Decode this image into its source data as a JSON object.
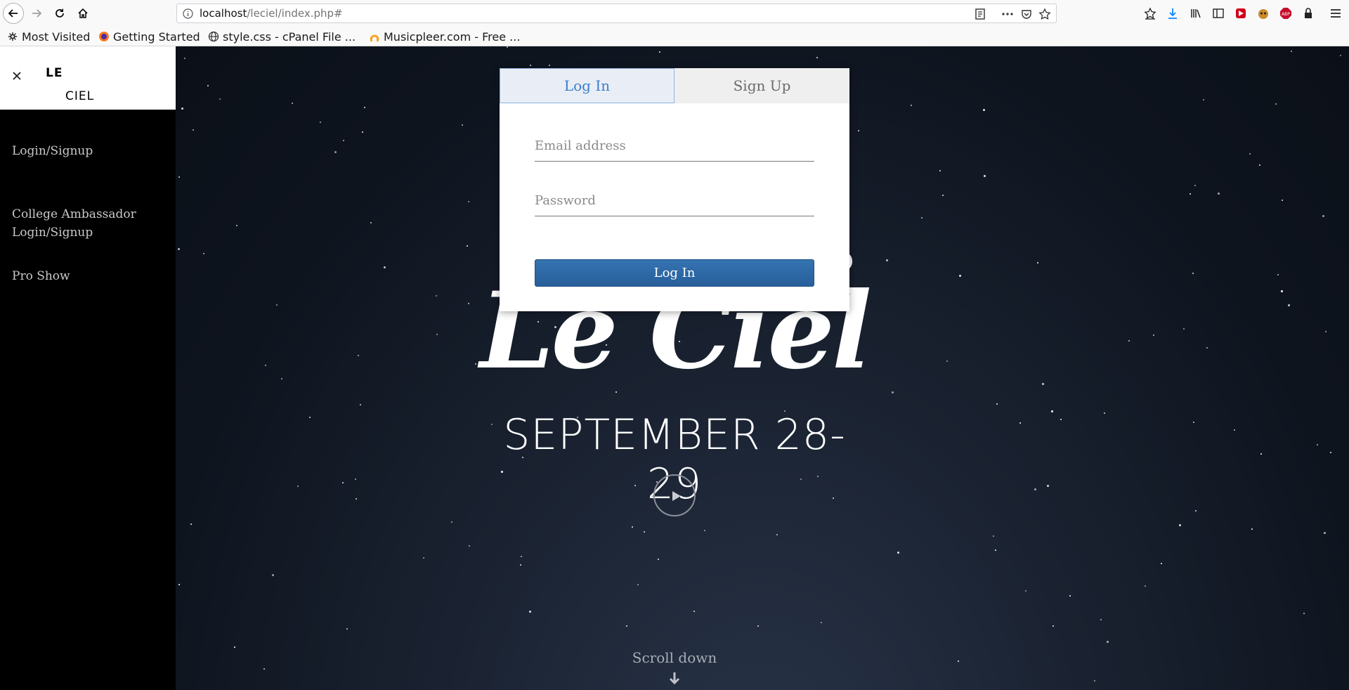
{
  "browser": {
    "url_host": "localhost",
    "url_path": "/leciel/index.php#",
    "bookmarks": [
      {
        "label": "Most Visited",
        "icon": "gear-icon"
      },
      {
        "label": "Getting Started",
        "icon": "firefox-icon"
      },
      {
        "label": "style.css - cPanel File ...",
        "icon": "globe-icon"
      },
      {
        "label": "Musicpleer.com - Free ...",
        "icon": "musicpleer-icon"
      }
    ]
  },
  "sidebar": {
    "brand_line1": "LE",
    "brand_line2": "CIEL",
    "links": [
      {
        "label": "Login/Signup"
      },
      {
        "label": "College Ambassador Login/Signup"
      },
      {
        "label": "Pro Show"
      }
    ]
  },
  "hero": {
    "logo_text": "Le Ciel",
    "date": "SEPTEMBER 28-29",
    "scroll_label": "Scroll down"
  },
  "modal": {
    "tabs": [
      {
        "label": "Log In",
        "active": true
      },
      {
        "label": "Sign Up",
        "active": false
      }
    ],
    "email_placeholder": "Email address",
    "password_placeholder": "Password",
    "submit_label": "Log In"
  },
  "colors": {
    "accent_tab_text": "#3b7dd0",
    "submit_button": "#2d6aa6",
    "sidebar_bg": "#000000",
    "hero_bg": "#131a26"
  }
}
